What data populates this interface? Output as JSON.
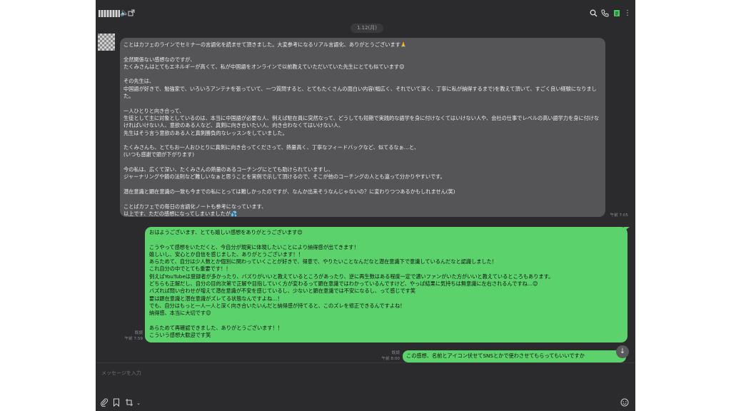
{
  "header": {
    "icons": [
      "mute-icon",
      "open-window-icon",
      "search-icon",
      "phone-icon",
      "notes-icon",
      "more-icon"
    ]
  },
  "date_label": "1.12(月)",
  "messages": {
    "received": {
      "text": "ことはカフェのラインでセミナーの言語化を読ませて頂きました。大変参考になるリアル言語化、ありがとうございます🙏\n\n全然関係ない感想なのですが、\nたくみさんはとてもエネルギーが高くて、私が中国語をオンラインで以前教えていただいていた先生にとても似ています😌\n\nその先生は、\n中国語が好きで、勉強家で、いろいろアンテナを張っていて、一つ質問すると、とてもたくさんの面白い内容(幅広く、それでいて深く、丁寧に私が納得するまで)を教えて頂いて、すごく良い経験になりました。\n\n一人ひとりと向き合って、\n生徒として主に対象としているのは、本当に中国語が必要な人、例えば駐在員に突然なって、どうしても短期で実践的な語学を身に付けなくてはいけない人や、会社の仕事でレベルの高い語学力を身に付けなければいけない人、意欲のある人など、真剣に向き合いたい人、向き合わなくてはいけない人、\n先生はそう言う意欲のある人と真剣勝負的なレッスンをしていました。\n\nたくみさんも、とてもお一人おひとりに真剣に向き合ってくださって、熱量高く、丁寧なフィードバックなど、似てるなぁ…と、\n(いつも感謝で頭が下がります)\n\n今の私は、広くて深い、たくみさんの熱量のあるコーチングにとても助けられていますし、\nジャーナリングや鏡の法則など難しいなぁと思うことを実例で示して頂けるので、そこが他のコーチングの人とも違って分かりやすいです。\n\n潜在意識と顕在意識の一致も今までの私にとっては難しかったのですが、なんか出来そうなんじゃないの？に変わりつつあるかもしれません(笑)\n\nことばカフェでの毎日の言語化ノートも参考になっています、\n以上です、ただの感想になってしまいましたが💦",
      "time": "午前 7:05"
    },
    "sent": {
      "text": "おはようございます、とても嬉しい感想をありがとうございます😊\n\nこうやって感想をいただくと、今自分が現実に体現したいことにより納得感が出てきます！\n嬉しいし、安心とか自信を感じました、ありがとうございます！！\nあらためて、自分は少人数とか個別に関わっていくことが好きで、得意で、やりたいことなんだなと潜在意識下で意識しているんだなと認識しました！\nこれ自分の中でとても重要です！！\n例えばYouTubeは登録者が多かったり、バズりがいいと教えているところがあったり、逆に再生数はある程度一定で濃いファンがいた方がいいと教えているところもあります。\nどちらも正解だし、自分の目的次第で正解や目指していく方が変わるって顕在意識ではわかっているんですけど、やっぱ結果に気持ちは無意識に左右されるんですね…😊\nバズれば問い合わせが増えて潜在意識が不安を感じているし、少ないと顕在意識では不安になるし、って感じです笑\n要は顕在意識と潜在意識がズレてる状態なんですよね…！\nでも、自分はもっと一人一人と深く向き合いたいんだと納得感が持てると、このズレを修正できるんですよね！\n納得感、本当に大切です😊\n\nあらためて再確認できました、ありがとうございます！！\nこういう感想大歓迎です笑",
      "read": "既読",
      "time": "午前 7:59"
    },
    "sent2": {
      "text": "この感想、名前とアイコン伏せてSNSとかで使わさせてもらってもいいですか",
      "read": "既読",
      "time": "午前 8:00"
    }
  },
  "composer": {
    "placeholder": "メッセージを入力"
  },
  "bottom_icons": [
    "paperclip-icon",
    "bookmark-icon",
    "screenshot-icon",
    "emoji-icon"
  ]
}
